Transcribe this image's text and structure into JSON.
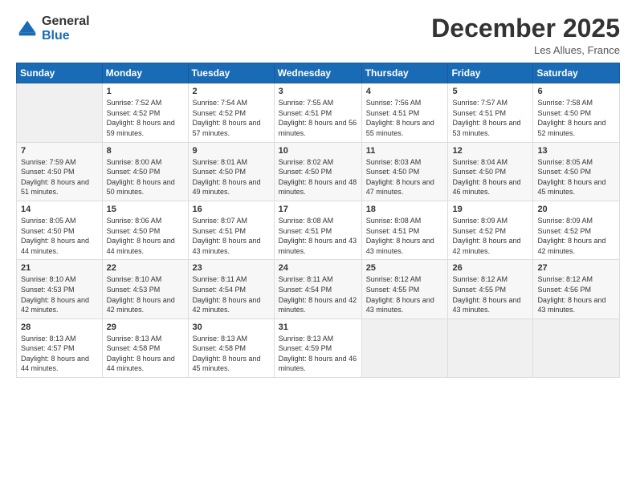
{
  "logo": {
    "general": "General",
    "blue": "Blue"
  },
  "header": {
    "title": "December 2025",
    "subtitle": "Les Allues, France"
  },
  "weekdays": [
    "Sunday",
    "Monday",
    "Tuesday",
    "Wednesday",
    "Thursday",
    "Friday",
    "Saturday"
  ],
  "weeks": [
    [
      {
        "day": "",
        "sunrise": "",
        "sunset": "",
        "daylight": ""
      },
      {
        "day": "1",
        "sunrise": "Sunrise: 7:52 AM",
        "sunset": "Sunset: 4:52 PM",
        "daylight": "Daylight: 8 hours and 59 minutes."
      },
      {
        "day": "2",
        "sunrise": "Sunrise: 7:54 AM",
        "sunset": "Sunset: 4:52 PM",
        "daylight": "Daylight: 8 hours and 57 minutes."
      },
      {
        "day": "3",
        "sunrise": "Sunrise: 7:55 AM",
        "sunset": "Sunset: 4:51 PM",
        "daylight": "Daylight: 8 hours and 56 minutes."
      },
      {
        "day": "4",
        "sunrise": "Sunrise: 7:56 AM",
        "sunset": "Sunset: 4:51 PM",
        "daylight": "Daylight: 8 hours and 55 minutes."
      },
      {
        "day": "5",
        "sunrise": "Sunrise: 7:57 AM",
        "sunset": "Sunset: 4:51 PM",
        "daylight": "Daylight: 8 hours and 53 minutes."
      },
      {
        "day": "6",
        "sunrise": "Sunrise: 7:58 AM",
        "sunset": "Sunset: 4:50 PM",
        "daylight": "Daylight: 8 hours and 52 minutes."
      }
    ],
    [
      {
        "day": "7",
        "sunrise": "Sunrise: 7:59 AM",
        "sunset": "Sunset: 4:50 PM",
        "daylight": "Daylight: 8 hours and 51 minutes."
      },
      {
        "day": "8",
        "sunrise": "Sunrise: 8:00 AM",
        "sunset": "Sunset: 4:50 PM",
        "daylight": "Daylight: 8 hours and 50 minutes."
      },
      {
        "day": "9",
        "sunrise": "Sunrise: 8:01 AM",
        "sunset": "Sunset: 4:50 PM",
        "daylight": "Daylight: 8 hours and 49 minutes."
      },
      {
        "day": "10",
        "sunrise": "Sunrise: 8:02 AM",
        "sunset": "Sunset: 4:50 PM",
        "daylight": "Daylight: 8 hours and 48 minutes."
      },
      {
        "day": "11",
        "sunrise": "Sunrise: 8:03 AM",
        "sunset": "Sunset: 4:50 PM",
        "daylight": "Daylight: 8 hours and 47 minutes."
      },
      {
        "day": "12",
        "sunrise": "Sunrise: 8:04 AM",
        "sunset": "Sunset: 4:50 PM",
        "daylight": "Daylight: 8 hours and 46 minutes."
      },
      {
        "day": "13",
        "sunrise": "Sunrise: 8:05 AM",
        "sunset": "Sunset: 4:50 PM",
        "daylight": "Daylight: 8 hours and 45 minutes."
      }
    ],
    [
      {
        "day": "14",
        "sunrise": "Sunrise: 8:05 AM",
        "sunset": "Sunset: 4:50 PM",
        "daylight": "Daylight: 8 hours and 44 minutes."
      },
      {
        "day": "15",
        "sunrise": "Sunrise: 8:06 AM",
        "sunset": "Sunset: 4:50 PM",
        "daylight": "Daylight: 8 hours and 44 minutes."
      },
      {
        "day": "16",
        "sunrise": "Sunrise: 8:07 AM",
        "sunset": "Sunset: 4:51 PM",
        "daylight": "Daylight: 8 hours and 43 minutes."
      },
      {
        "day": "17",
        "sunrise": "Sunrise: 8:08 AM",
        "sunset": "Sunset: 4:51 PM",
        "daylight": "Daylight: 8 hours and 43 minutes."
      },
      {
        "day": "18",
        "sunrise": "Sunrise: 8:08 AM",
        "sunset": "Sunset: 4:51 PM",
        "daylight": "Daylight: 8 hours and 43 minutes."
      },
      {
        "day": "19",
        "sunrise": "Sunrise: 8:09 AM",
        "sunset": "Sunset: 4:52 PM",
        "daylight": "Daylight: 8 hours and 42 minutes."
      },
      {
        "day": "20",
        "sunrise": "Sunrise: 8:09 AM",
        "sunset": "Sunset: 4:52 PM",
        "daylight": "Daylight: 8 hours and 42 minutes."
      }
    ],
    [
      {
        "day": "21",
        "sunrise": "Sunrise: 8:10 AM",
        "sunset": "Sunset: 4:53 PM",
        "daylight": "Daylight: 8 hours and 42 minutes."
      },
      {
        "day": "22",
        "sunrise": "Sunrise: 8:10 AM",
        "sunset": "Sunset: 4:53 PM",
        "daylight": "Daylight: 8 hours and 42 minutes."
      },
      {
        "day": "23",
        "sunrise": "Sunrise: 8:11 AM",
        "sunset": "Sunset: 4:54 PM",
        "daylight": "Daylight: 8 hours and 42 minutes."
      },
      {
        "day": "24",
        "sunrise": "Sunrise: 8:11 AM",
        "sunset": "Sunset: 4:54 PM",
        "daylight": "Daylight: 8 hours and 42 minutes."
      },
      {
        "day": "25",
        "sunrise": "Sunrise: 8:12 AM",
        "sunset": "Sunset: 4:55 PM",
        "daylight": "Daylight: 8 hours and 43 minutes."
      },
      {
        "day": "26",
        "sunrise": "Sunrise: 8:12 AM",
        "sunset": "Sunset: 4:55 PM",
        "daylight": "Daylight: 8 hours and 43 minutes."
      },
      {
        "day": "27",
        "sunrise": "Sunrise: 8:12 AM",
        "sunset": "Sunset: 4:56 PM",
        "daylight": "Daylight: 8 hours and 43 minutes."
      }
    ],
    [
      {
        "day": "28",
        "sunrise": "Sunrise: 8:13 AM",
        "sunset": "Sunset: 4:57 PM",
        "daylight": "Daylight: 8 hours and 44 minutes."
      },
      {
        "day": "29",
        "sunrise": "Sunrise: 8:13 AM",
        "sunset": "Sunset: 4:58 PM",
        "daylight": "Daylight: 8 hours and 44 minutes."
      },
      {
        "day": "30",
        "sunrise": "Sunrise: 8:13 AM",
        "sunset": "Sunset: 4:58 PM",
        "daylight": "Daylight: 8 hours and 45 minutes."
      },
      {
        "day": "31",
        "sunrise": "Sunrise: 8:13 AM",
        "sunset": "Sunset: 4:59 PM",
        "daylight": "Daylight: 8 hours and 46 minutes."
      },
      {
        "day": "",
        "sunrise": "",
        "sunset": "",
        "daylight": ""
      },
      {
        "day": "",
        "sunrise": "",
        "sunset": "",
        "daylight": ""
      },
      {
        "day": "",
        "sunrise": "",
        "sunset": "",
        "daylight": ""
      }
    ]
  ]
}
